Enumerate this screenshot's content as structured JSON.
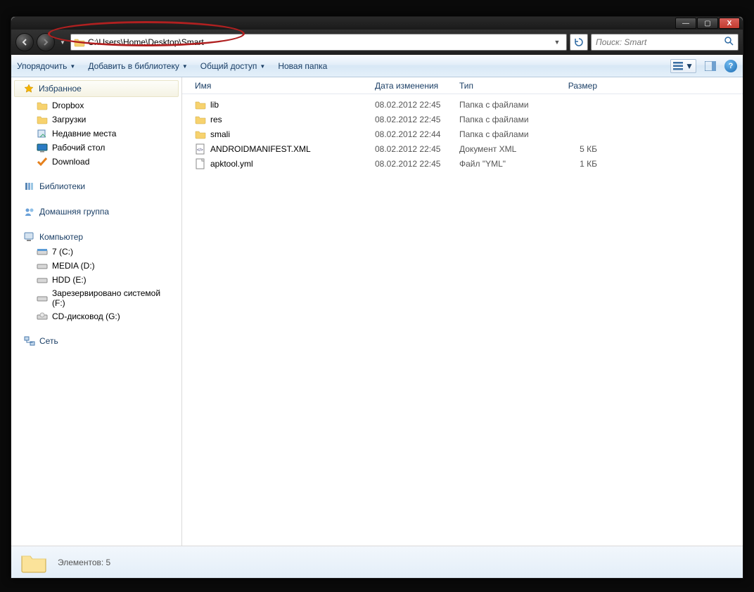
{
  "window_controls": {
    "min": "—",
    "max": "▢",
    "close": "X"
  },
  "address_path": "C:\\Users\\Home\\Desktop\\Smart",
  "search_placeholder": "Поиск: Smart",
  "toolbar": {
    "organize": "Упорядочить",
    "add_library": "Добавить в библиотеку",
    "share": "Общий доступ",
    "new_folder": "Новая папка"
  },
  "sidebar": {
    "favorites": {
      "header": "Избранное",
      "items": [
        "Dropbox",
        "Загрузки",
        "Недавние места",
        "Рабочий стол",
        "Download"
      ]
    },
    "libraries": {
      "header": "Библиотеки"
    },
    "homegroup": {
      "header": "Домашняя группа"
    },
    "computer": {
      "header": "Компьютер",
      "items": [
        "7 (C:)",
        "MEDIA (D:)",
        "HDD (E:)",
        "Зарезервировано системой (F:)",
        "CD-дисковод (G:)"
      ]
    },
    "network": {
      "header": "Сеть"
    }
  },
  "columns": {
    "name": "Имя",
    "date": "Дата изменения",
    "type": "Тип",
    "size": "Размер"
  },
  "files": [
    {
      "icon": "folder",
      "name": "lib",
      "date": "08.02.2012 22:45",
      "type": "Папка с файлами",
      "size": ""
    },
    {
      "icon": "folder",
      "name": "res",
      "date": "08.02.2012 22:45",
      "type": "Папка с файлами",
      "size": ""
    },
    {
      "icon": "folder",
      "name": "smali",
      "date": "08.02.2012 22:44",
      "type": "Папка с файлами",
      "size": ""
    },
    {
      "icon": "xml",
      "name": "ANDROIDMANIFEST.XML",
      "date": "08.02.2012 22:45",
      "type": "Документ XML",
      "size": "5 КБ"
    },
    {
      "icon": "file",
      "name": "apktool.yml",
      "date": "08.02.2012 22:45",
      "type": "Файл \"YML\"",
      "size": "1 КБ"
    }
  ],
  "status": {
    "label": "Элементов:",
    "count": "5"
  }
}
